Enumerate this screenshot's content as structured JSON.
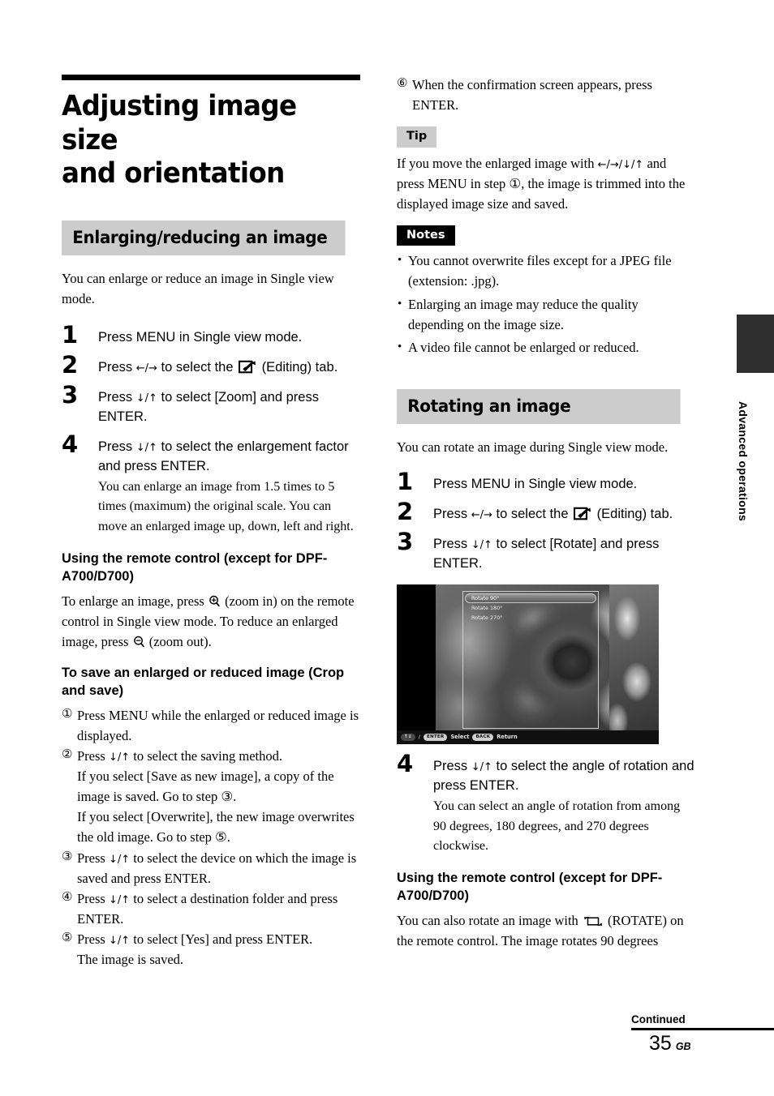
{
  "chapter": {
    "title_line1": "Adjusting image size",
    "title_line2": "and orientation"
  },
  "section_enlarge": {
    "heading": "Enlarging/reducing an image",
    "intro": "You can enlarge or reduce an image in Single view mode.",
    "steps": [
      {
        "num": "1",
        "text_before": "Press MENU in Single view mode.",
        "text_after": "",
        "sub": ""
      },
      {
        "num": "2",
        "text_before": "Press ",
        "arrows": "←/→",
        "text_mid": " to select the ",
        "icon": "editing-icon",
        "text_after": " (Editing) tab.",
        "sub": ""
      },
      {
        "num": "3",
        "text_before": "Press ",
        "arrows": "↓/↑",
        "text_after": " to select [Zoom] and press ENTER.",
        "sub": ""
      },
      {
        "num": "4",
        "text_before": "Press ",
        "arrows": "↓/↑",
        "text_after": " to select the enlargement factor and press ENTER.",
        "sub": "You can enlarge an image from 1.5 times to 5 times (maximum) the original scale. You can move an enlarged image up, down, left and right."
      }
    ],
    "remote_heading": "Using the remote control (except for DPF-A700/D700)",
    "remote_text_1": "To enlarge an image, press ",
    "remote_text_2": " (zoom in) on the remote control in Single view mode. To reduce an enlarged image, press ",
    "remote_text_3": " (zoom out).",
    "save_heading": "To save an enlarged or reduced image (Crop and save)",
    "save_steps": [
      {
        "mark": "①",
        "text": "Press MENU while the enlarged or reduced image is displayed.",
        "extra": []
      },
      {
        "mark": "②",
        "text_before": "Press ",
        "arrows": "↓/↑",
        "text_after": " to select the saving method.",
        "extra": [
          "If you select [Save as new image], a copy of the image is saved. Go to step ③.",
          "If you select [Overwrite], the new image overwrites the old image. Go to step ⑤."
        ]
      },
      {
        "mark": "③",
        "text_before": "Press ",
        "arrows": "↓/↑",
        "text_after": " to select the device on which the image is saved and press ENTER.",
        "extra": []
      },
      {
        "mark": "④",
        "text_before": "Press ",
        "arrows": "↓/↑",
        "text_after": " to select a destination folder and press ENTER.",
        "extra": []
      },
      {
        "mark": "⑤",
        "text_before": "Press ",
        "arrows": "↓/↑",
        "text_after": " to select [Yes] and press ENTER.",
        "extra": [
          "The image is saved."
        ]
      }
    ]
  },
  "right_top": {
    "step6_mark": "⑥",
    "step6_text": "When the confirmation screen appears, press ENTER.",
    "tip_badge": "Tip",
    "tip_text_1": "If you move the enlarged image with ",
    "tip_arrows": "←/→/↓/↑",
    "tip_text_2": " and press MENU in step ①, the image is trimmed into the displayed image size and saved.",
    "notes_badge": "Notes",
    "notes": [
      "You cannot overwrite files except for a JPEG file (extension: .jpg).",
      "Enlarging an image may reduce the quality depending on the image size.",
      "A video file cannot be enlarged or reduced."
    ]
  },
  "section_rotate": {
    "heading": "Rotating an image",
    "intro": "You can rotate an image during Single view mode.",
    "steps": [
      {
        "num": "1",
        "text_before": "Press MENU in Single view mode.",
        "text_after": ""
      },
      {
        "num": "2",
        "text_before": "Press ",
        "arrows": "←/→",
        "text_mid": " to select the ",
        "text_after": " (Editing) tab."
      },
      {
        "num": "3",
        "text_before": "Press ",
        "arrows": "↓/↑",
        "text_after": " to select [Rotate] and press ENTER."
      },
      {
        "num": "4",
        "text_before": "Press ",
        "arrows": "↓/↑",
        "text_after": " to select the angle of rotation and press ENTER.",
        "sub": "You can select an angle of rotation from among 90 degrees, 180 degrees, and 270 degrees clockwise."
      }
    ],
    "screenshot": {
      "menu_items": [
        "Rotate 90°",
        "Rotate 180°",
        "Rotate 270°"
      ],
      "selected_index": 0,
      "statusbar": {
        "dpad": "↑↓",
        "slash": "/",
        "enter_key": "ENTER",
        "enter_label": "Select",
        "back_key": "BACK",
        "back_label": "Return"
      }
    },
    "remote_heading": "Using the remote control (except for DPF-A700/D700)",
    "remote_text_1": "You can also rotate an image with ",
    "remote_text_2": " (ROTATE) on the remote control. The image rotates 90 degrees"
  },
  "side": {
    "label": "Advanced operations"
  },
  "footer": {
    "continued": "Continued",
    "page_number": "35",
    "region": "GB"
  },
  "colors": {
    "section_bar": "#cccccc",
    "notes_badge_bg": "#000000",
    "side_tab": "#2e2e2e"
  }
}
